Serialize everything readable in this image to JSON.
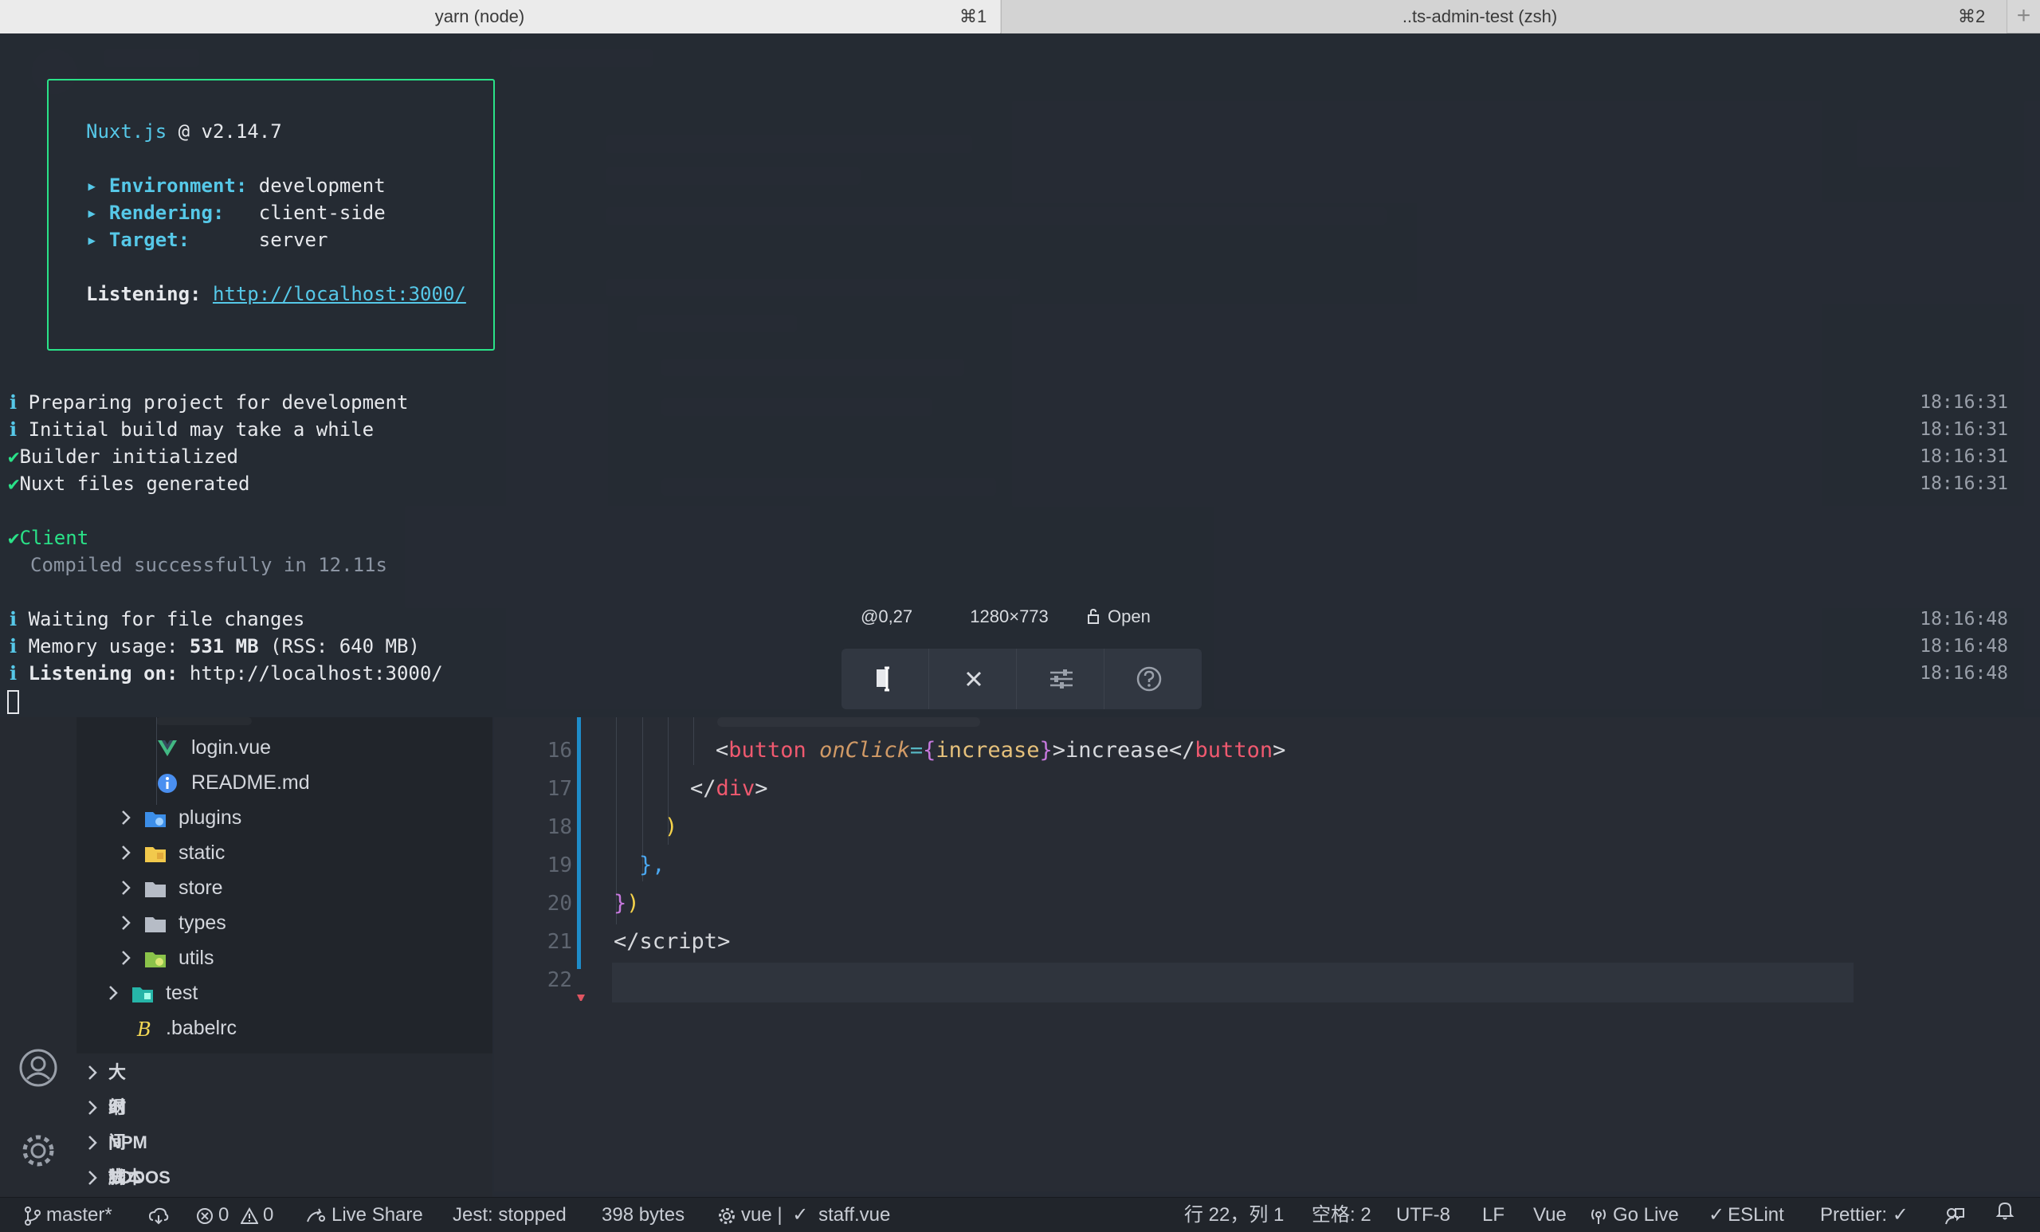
{
  "tabs": [
    {
      "title": "yarn (node)",
      "shortcut": "⌘1"
    },
    {
      "title": "..ts-admin-test (zsh)",
      "shortcut": "⌘2"
    }
  ],
  "terminal": {
    "nuxt_name": "Nuxt.js",
    "nuxt_version": " @ v2.14.7",
    "env_label": "▸ Environment:",
    "env_value": " development",
    "render_label": "▸ Rendering:",
    "render_value": "   client-side",
    "target_label": "▸ Target:",
    "target_value": "      server",
    "listening_label": "Listening:",
    "listening_url": "http://localhost:3000/",
    "lines": [
      {
        "prefix": "ℹ",
        "text": "Preparing project for development",
        "time": "18:16:31"
      },
      {
        "prefix": "ℹ",
        "text": "Initial build may take a while",
        "time": "18:16:31"
      },
      {
        "prefix": "✔",
        "text": "Builder initialized",
        "time": "18:16:31"
      },
      {
        "prefix": "✔",
        "text": "Nuxt files generated",
        "time": "18:16:31"
      }
    ],
    "client_label": "Client",
    "compiled": "Compiled successfully in 12.11s",
    "waiting": "Waiting for file changes",
    "waiting_time": "18:16:48",
    "memory_prefix": "Memory usage: ",
    "memory_value": "531 MB",
    "memory_suffix": " (RSS: 640 MB)",
    "memory_time": "18:16:48",
    "listening_on_label": "Listening on:",
    "listening_on_url": " http://localhost:3000/",
    "listening_on_time": "18:16:48"
  },
  "screenshot_tool": {
    "position": "@0,27",
    "size": "1280×773",
    "lock_label": "Open"
  },
  "explorer": {
    "items": [
      {
        "label": "login.vue",
        "icon": "vue-icon"
      },
      {
        "label": "README.md",
        "icon": "info-icon"
      },
      {
        "label": "plugins",
        "icon": "folder-plugins-icon"
      },
      {
        "label": "static",
        "icon": "folder-static-icon"
      },
      {
        "label": "store",
        "icon": "folder-icon"
      },
      {
        "label": "types",
        "icon": "folder-icon"
      },
      {
        "label": "utils",
        "icon": "folder-utils-icon"
      },
      {
        "label": "test",
        "icon": "folder-test-icon"
      },
      {
        "label": ".babelrc",
        "icon": "babel-icon"
      }
    ]
  },
  "sections": [
    "大纲",
    "时间线",
    "NPM 脚本",
    "TODOS"
  ],
  "editor": {
    "line_numbers": [
      "16",
      "17",
      "18",
      "19",
      "20",
      "21",
      "22"
    ],
    "code": {
      "l16_open": "<",
      "l16_tag": "button",
      "l16_attr": "onClick",
      "l16_eq": "=",
      "l16_brace_open": "{",
      "l16_var": "increase",
      "l16_brace_close": "}",
      "l16_gt": ">",
      "l16_text": "increase",
      "l16_close": "</",
      "l16_tag2": "button",
      "l16_end": ">",
      "l17_open": "</",
      "l17_tag": "div",
      "l17_end": ">",
      "l18": ")",
      "l19": "},",
      "l20_brace": "}",
      "l20_paren": ")",
      "l21_open": "</",
      "l21_tag": "script",
      "l21_end": ">"
    }
  },
  "statusbar": {
    "branch": "master*",
    "errors": "0",
    "warnings": "0",
    "live_share": "Live Share",
    "jest": "Jest: stopped",
    "size": "398 bytes",
    "vue_label": "vue |",
    "file_label": "staff.vue",
    "position": "行 22，列 1",
    "spaces": "空格: 2",
    "encoding": "UTF-8",
    "eol": "LF",
    "language": "Vue",
    "go_live": "Go Live",
    "eslint": "ESLint",
    "prettier": "Prettier: ✓"
  }
}
